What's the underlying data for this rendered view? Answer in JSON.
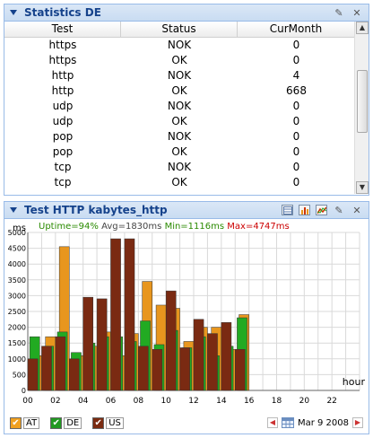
{
  "stats_panel": {
    "title": "Statistics DE",
    "columns": [
      "Test",
      "Status",
      "CurMonth"
    ],
    "rows": [
      [
        "https",
        "NOK",
        "0"
      ],
      [
        "https",
        "OK",
        "0"
      ],
      [
        "http",
        "NOK",
        "4"
      ],
      [
        "http",
        "OK",
        "668"
      ],
      [
        "udp",
        "NOK",
        "0"
      ],
      [
        "udp",
        "OK",
        "0"
      ],
      [
        "pop",
        "NOK",
        "0"
      ],
      [
        "pop",
        "OK",
        "0"
      ],
      [
        "tcp",
        "NOK",
        "0"
      ],
      [
        "tcp",
        "OK",
        "0"
      ]
    ]
  },
  "chart_panel": {
    "title": "Test HTTP kabytes_http",
    "stats": {
      "uptime": "Uptime=94%",
      "avg": "Avg=1830ms",
      "min": "Min=1116ms",
      "max": "Max=4747ms"
    },
    "date": "Mar 9 2008",
    "checkboxes": [
      {
        "label": "AT",
        "color": "#f0a020"
      },
      {
        "label": "DE",
        "color": "#229922"
      },
      {
        "label": "US",
        "color": "#7a2a10"
      }
    ]
  },
  "colors": {
    "AT": "#e8961e",
    "DE": "#22aa22",
    "US": "#7a2a12",
    "header": "#15428b"
  },
  "icons": [
    "collapse-triangle-icon",
    "edit-pencil-icon",
    "close-icon",
    "table-view-icon",
    "bar-chart-icon",
    "line-chart-icon",
    "prev-arrow-icon",
    "calendar-icon",
    "next-arrow-icon",
    "checkmark-icon"
  ],
  "chart_data": {
    "type": "bar",
    "ylabel": "ms",
    "xlabel": "hour",
    "ylim": [
      0,
      5000
    ],
    "xlim": [
      0,
      24
    ],
    "yticks": [
      "0",
      "500",
      "1000",
      "1500",
      "2000",
      "2500",
      "3000",
      "3500",
      "4000",
      "4500",
      "5000"
    ],
    "xticks": [
      "00",
      "02",
      "04",
      "06",
      "08",
      "10",
      "12",
      "14",
      "16",
      "18",
      "20",
      "22"
    ],
    "grid": true,
    "series": [
      {
        "name": "AT",
        "x": [
          0,
          1,
          2,
          3,
          4,
          5,
          6,
          7,
          8,
          9,
          10,
          11,
          12,
          13,
          14,
          15
        ],
        "values": [
          1100,
          1700,
          4550,
          1100,
          1400,
          1850,
          1100,
          1800,
          3450,
          2700,
          2600,
          1550,
          2000,
          2000,
          1300,
          2400
        ]
      },
      {
        "name": "DE",
        "x": [
          0,
          1,
          2,
          3,
          4,
          5,
          6,
          7,
          8,
          9,
          10,
          11,
          12,
          13,
          14,
          15
        ],
        "values": [
          1700,
          1400,
          1850,
          1200,
          1500,
          1700,
          1700,
          1550,
          2200,
          1450,
          1900,
          1350,
          1700,
          1100,
          1400,
          2300
        ]
      },
      {
        "name": "US",
        "x": [
          0,
          1,
          2,
          3,
          4,
          5,
          6,
          7,
          8,
          9,
          10,
          11,
          12,
          13,
          14,
          15
        ],
        "values": [
          1000,
          1400,
          1700,
          1000,
          2950,
          2900,
          4800,
          4800,
          1400,
          1300,
          3150,
          1350,
          2250,
          1800,
          2150,
          1300
        ]
      }
    ]
  }
}
